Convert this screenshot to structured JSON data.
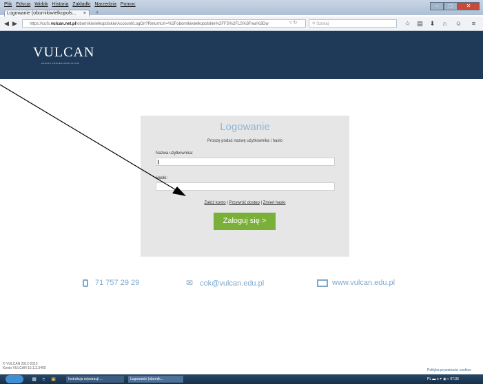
{
  "browser": {
    "menu": [
      "Plik",
      "Edycja",
      "Widok",
      "Historia",
      "Zakładki",
      "Narzędzia",
      "Pomoc"
    ],
    "tab_title": "Logowanie (obornikiwielkopols...",
    "tab_close": "×",
    "new_tab": "+",
    "url_prefix": "https://cufs.",
    "url_domain": "vulcan.net.pl",
    "url_rest": "/obornikiwielkopolskie/Account/LogOn?ReturnUrl=%2Fobornikiwielkopolskie%2FFS%2FLS%3Fwa%3Dw",
    "search_placeholder": "Szukaj"
  },
  "header": {
    "logo": "VULCAN",
    "logo_sub": "ZAUFAJ PROFESJONALISTOM"
  },
  "login": {
    "title": "Logowanie",
    "prompt": "Proszę podać nazwę użytkownika i hasło",
    "username_label": "Nazwa użytkownika:",
    "password_label": "Hasło:",
    "link_create": "Załóż konto",
    "link_restore": "Przywróć dostęp",
    "link_change": "Zmień hasło",
    "separator": "|",
    "submit": "Zaloguj się >"
  },
  "contacts": {
    "phone": "71 757 29 29",
    "email": "cok@vulcan.edu.pl",
    "web": "www.vulcan.edu.pl"
  },
  "footer": {
    "copyright": "© VULCAN 2012-2015",
    "version": "Konto VULCAN 15.1.2.3409",
    "cookies": "Polityka prywatności cookies"
  },
  "taskbar": {
    "item1": "Instrukcja rejestracji ...",
    "item2": "Logowanie (obornik...",
    "clock": "07:35",
    "lang": "PL"
  },
  "colors": {
    "header_bg": "#1f3a58",
    "accent_green": "#7ab03a",
    "title_blue": "#8db6d8"
  }
}
